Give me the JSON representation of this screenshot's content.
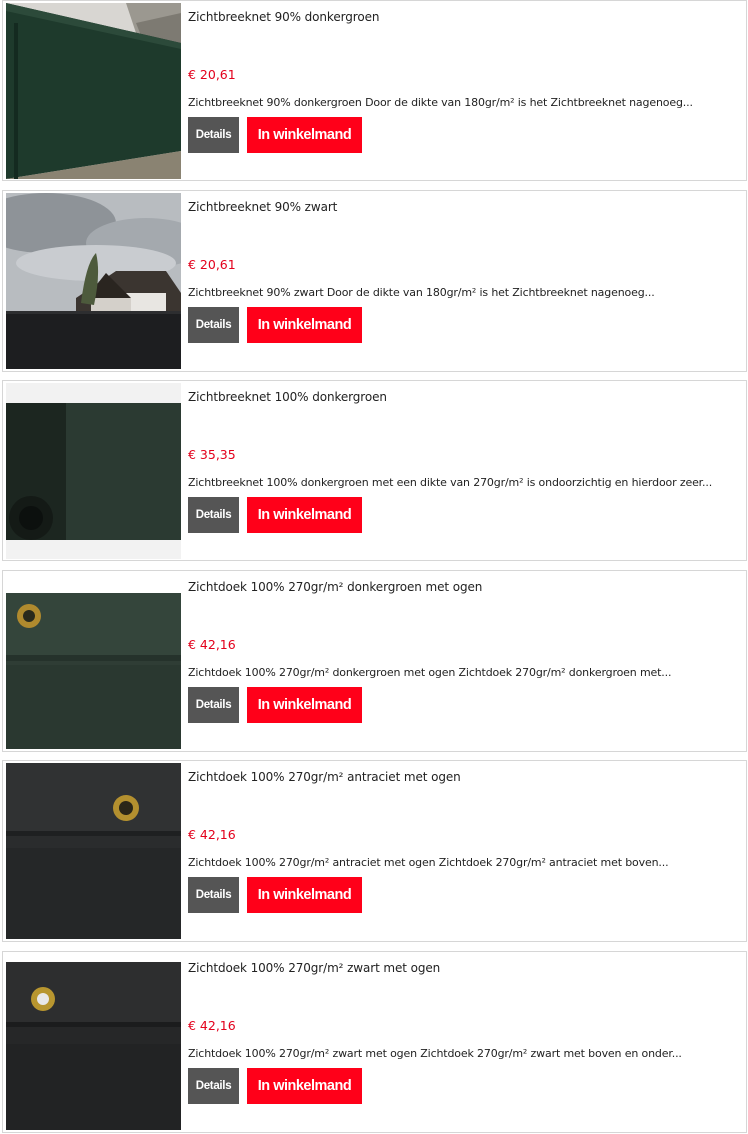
{
  "products": [
    {
      "title": "Zichtbreeknet 90% donkergroen",
      "price": "€ 20,61",
      "description": "Zichtbreeknet 90% donkergroen Door de dikte van 180gr/m² is het Zichtbreeknet nagenoeg...",
      "details_label": "Details",
      "cart_label": "In winkelmand",
      "image": "fence-green-photo"
    },
    {
      "title": "Zichtbreeknet 90% zwart",
      "price": "€ 20,61",
      "description": "Zichtbreeknet 90% zwart Door de dikte van 180gr/m² is het Zichtbreeknet nagenoeg...",
      "details_label": "Details",
      "cart_label": "In winkelmand",
      "image": "house-black-fence-photo"
    },
    {
      "title": "Zichtbreeknet 100% donkergroen",
      "price": "€ 35,35",
      "description": "Zichtbreeknet 100% donkergroen met een dikte van 270gr/m² is ondoorzichtig en hierdoor zeer...",
      "details_label": "Details",
      "cart_label": "In winkelmand",
      "image": "green-roll-photo"
    },
    {
      "title": "Zichtdoek 100% 270gr/m² donkergroen met ogen",
      "price": "€ 42,16",
      "description": "Zichtdoek 100% 270gr/m² donkergroen met ogen Zichtdoek 270gr/m² donkergroen met...",
      "details_label": "Details",
      "cart_label": "In winkelmand",
      "image": "green-cloth-grommet-photo"
    },
    {
      "title": "Zichtdoek 100% 270gr/m² antraciet met ogen",
      "price": "€ 42,16",
      "description": "Zichtdoek 100% 270gr/m² antraciet met ogen Zichtdoek 270gr/m² antraciet met boven...",
      "details_label": "Details",
      "cart_label": "In winkelmand",
      "image": "anthracite-cloth-grommet-photo"
    },
    {
      "title": "Zichtdoek 100% 270gr/m² zwart met ogen",
      "price": "€ 42,16",
      "description": "Zichtdoek 100% 270gr/m² zwart met ogen Zichtdoek 270gr/m² zwart met boven en onder...",
      "details_label": "Details",
      "cart_label": "In winkelmand",
      "image": "black-cloth-grommet-photo"
    }
  ],
  "colors": {
    "price": "#e3001b",
    "cart_button": "#ff0019",
    "details_button": "#555555",
    "border": "#d6d6d6"
  }
}
